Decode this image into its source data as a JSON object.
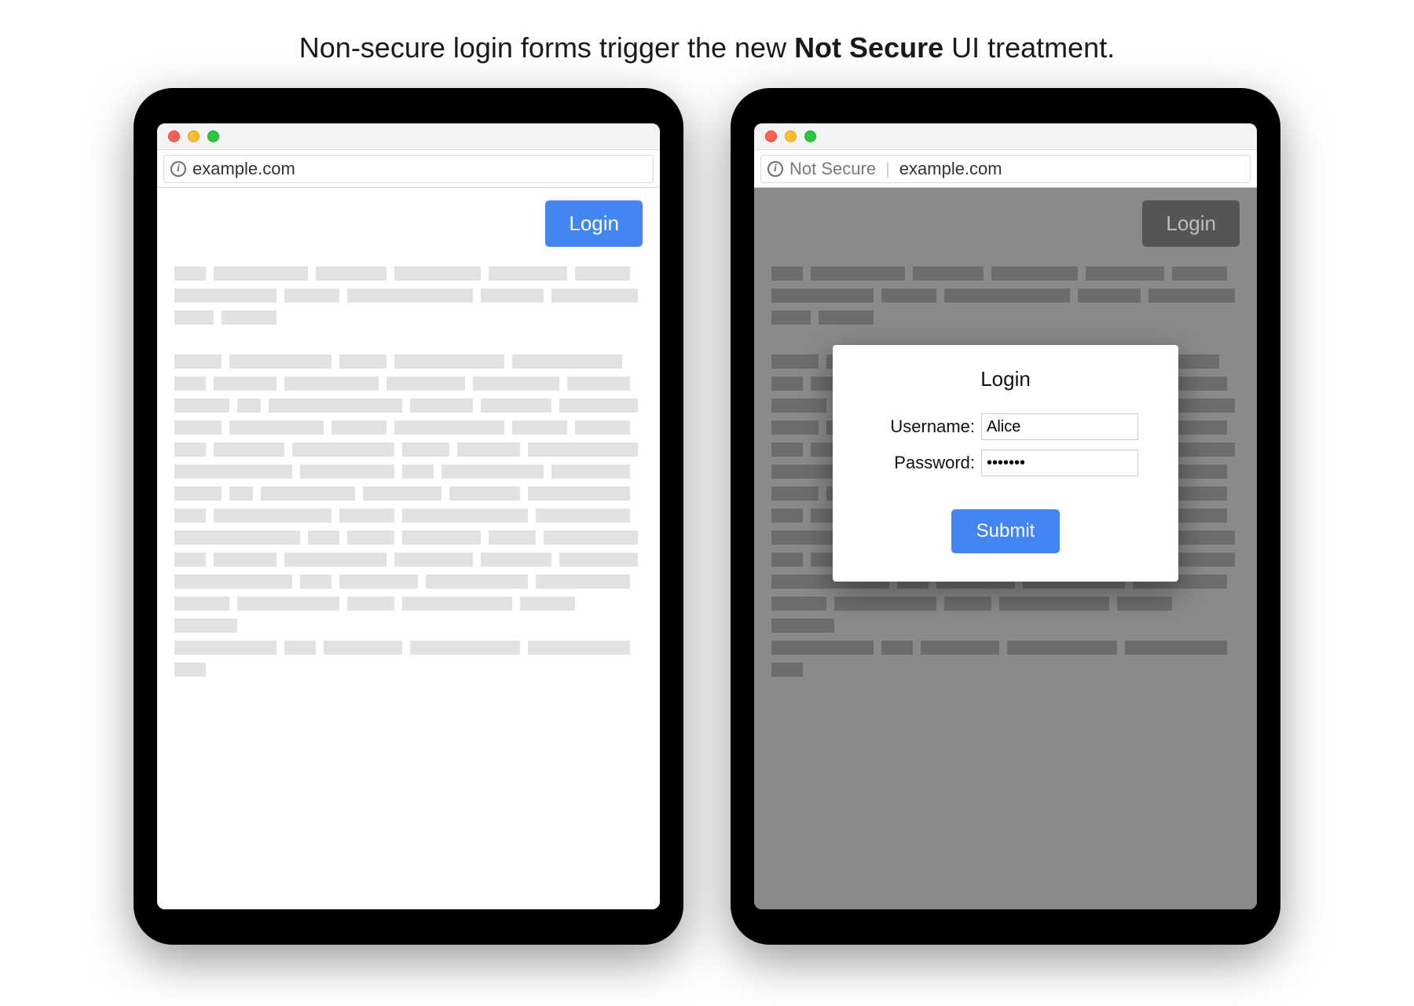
{
  "caption": {
    "pre": "Non-secure login forms trigger the new ",
    "bold": "Not Secure",
    "post": " UI treatment."
  },
  "left": {
    "url": "example.com",
    "login_button": "Login"
  },
  "right": {
    "not_secure_label": "Not Secure",
    "url": "example.com",
    "login_button": "Login",
    "dialog": {
      "title": "Login",
      "username_label": "Username:",
      "username_value": "Alice",
      "password_label": "Password:",
      "password_value": "•••••••",
      "submit_label": "Submit"
    }
  },
  "colors": {
    "primary_button": "#4286f4",
    "dim_bg": "#8a8a8a"
  }
}
